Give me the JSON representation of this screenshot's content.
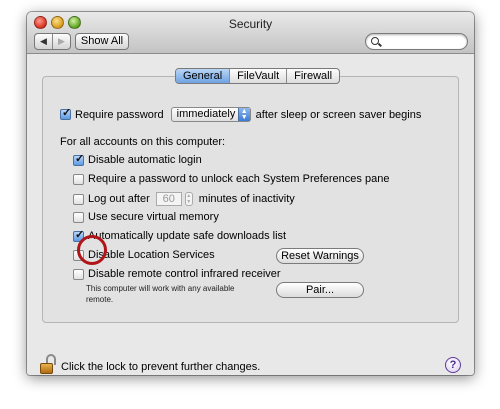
{
  "window": {
    "title": "Security"
  },
  "toolbar": {
    "back_glyph": "◀",
    "forward_glyph": "▶",
    "show_all_label": "Show All",
    "search_placeholder": ""
  },
  "tabs": [
    {
      "label": "General",
      "selected": true
    },
    {
      "label": "FileVault",
      "selected": false
    },
    {
      "label": "Firewall",
      "selected": false
    }
  ],
  "general": {
    "require_password": {
      "checked": true,
      "label": "Require password",
      "popup_value": "immediately",
      "suffix": "after sleep or screen saver begins"
    },
    "all_accounts_heading": "For all accounts on this computer:",
    "options": [
      {
        "label": "Disable automatic login",
        "checked": true
      },
      {
        "label": "Require a password to unlock each System Preferences pane",
        "checked": false
      },
      {
        "label": "Log out after",
        "checked": false,
        "minutes_value": "60",
        "suffix": "minutes of inactivity"
      },
      {
        "label": "Use secure virtual memory",
        "checked": false
      },
      {
        "label": "Automatically update safe downloads list",
        "checked": true
      },
      {
        "label": "Disable Location Services",
        "checked": false
      },
      {
        "label": "Disable remote control infrared receiver",
        "checked": false
      }
    ],
    "reset_warnings_label": "Reset Warnings",
    "pair_label": "Pair...",
    "infrared_note_line1": "This computer will work with any available",
    "infrared_note_line2": "remote."
  },
  "footer": {
    "lock_text": "Click the lock to prevent further changes.",
    "help_glyph": "?"
  },
  "colors": {
    "annotation_circle": "#b0151a",
    "selected_tab": "#6fa3e3",
    "checkbox_checked": "#5d9ae5"
  },
  "icons": [
    "close-icon",
    "minimize-icon",
    "zoom-icon",
    "search-icon",
    "lock-icon",
    "help-icon"
  ]
}
